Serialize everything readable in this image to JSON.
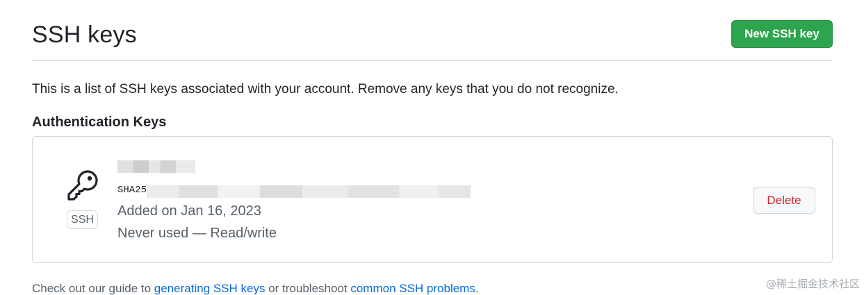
{
  "header": {
    "title": "SSH keys",
    "new_key_label": "New SSH key"
  },
  "intro": "This is a list of SSH keys associated with your account. Remove any keys that you do not recognize.",
  "auth_section": {
    "heading": "Authentication Keys",
    "keys": [
      {
        "type_label": "SSH",
        "fingerprint_prefix": "SHA25",
        "added": "Added on Jan 16, 2023",
        "usage": "Never used — Read/write",
        "delete_label": "Delete"
      }
    ]
  },
  "footer": {
    "before": "Check out our guide to ",
    "link1": "generating SSH keys",
    "middle": " or troubleshoot ",
    "link2": "common SSH problems",
    "after": "."
  },
  "watermark": "@稀土掘金技术社区",
  "colors": {
    "primary_button": "#2da44e",
    "danger_text": "#cf222e",
    "link": "#0969da",
    "muted_text": "#57606a",
    "border": "#d0d7de"
  },
  "icons": {
    "key": "key-icon"
  }
}
